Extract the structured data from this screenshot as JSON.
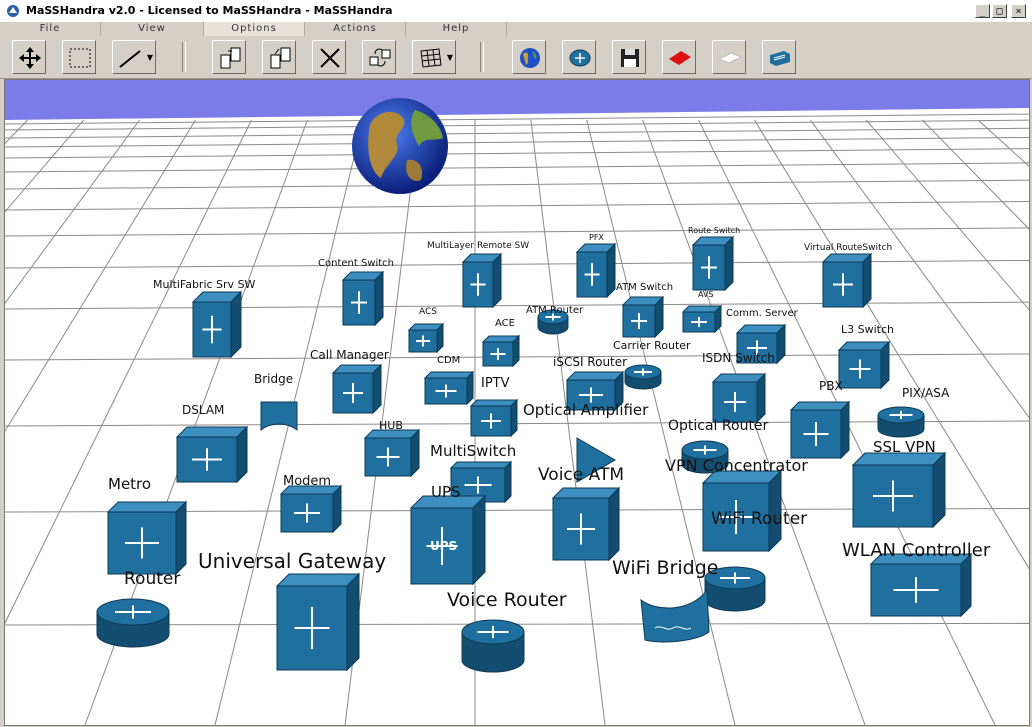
{
  "window": {
    "title": "MaSSHandra v2.0 - Licensed to MaSSHandra - MaSSHandra",
    "minimize": "_",
    "maximize": "□",
    "close": "×"
  },
  "menu": [
    {
      "label": "File"
    },
    {
      "label": "View"
    },
    {
      "label": "Options"
    },
    {
      "label": "Actions"
    },
    {
      "label": "Help"
    }
  ],
  "toolbar": {
    "tools": [
      "move-arrows-icon",
      "select-rectangle-icon",
      "line-draw-icon",
      "copy-node-icon",
      "paste-node-icon",
      "delete-x-icon",
      "rotate-swap-icon",
      "grid-icon",
      "globe-icon",
      "router-icon",
      "floppy-save-icon",
      "red-plane-icon",
      "white-plane-icon",
      "switch-icon"
    ]
  },
  "scene": {
    "colors": {
      "sky": "#7b7bea",
      "floor": "#ffffff",
      "device": "#1f6f9f",
      "device_dark": "#134d70"
    },
    "labels": {
      "multifabric": "MultiFabric Srv SW",
      "content_switch": "Content Switch",
      "multilayer": "MultiLayer Remote SW",
      "pfx": "PFX",
      "route_switch": "Route Switch",
      "virtual_routeswitch": "Virtual RouteSwitch",
      "acs": "ACS",
      "ace": "ACE",
      "atm_router": "ATM Router",
      "atm_switch": "ATM Switch",
      "avs": "AVS",
      "comm_server": "Comm. Server",
      "l3_switch": "L3 Switch",
      "call_manager": "Call Manager",
      "cdm": "CDM",
      "carrier_router": "Carrier Router",
      "isdn_switch": "ISDN Switch",
      "bridge": "Bridge",
      "iptv": "IPTV",
      "iscsi_router": "iSCSI Router",
      "pbx": "PBX",
      "pix_asa": "PIX/ASA",
      "dslam": "DSLAM",
      "optical_amplifier": "Optical Amplifier",
      "hub": "HUB",
      "optical_router": "Optical Router",
      "ssl_vpn": "SSL VPN",
      "multiswitch": "MultiSwitch",
      "vpn_concentrator": "VPN Concentrator",
      "metro": "Metro",
      "modem": "Modem",
      "voice_atm": "Voice ATM",
      "ups": "UPS",
      "ups_box": "UPS",
      "wifi_router": "WiFi Router",
      "universal_gateway": "Universal Gateway",
      "wlan_controller": "WLAN Controller",
      "router": "Router",
      "wifi_bridge": "WiFi Bridge",
      "voice_router": "Voice Router"
    }
  }
}
